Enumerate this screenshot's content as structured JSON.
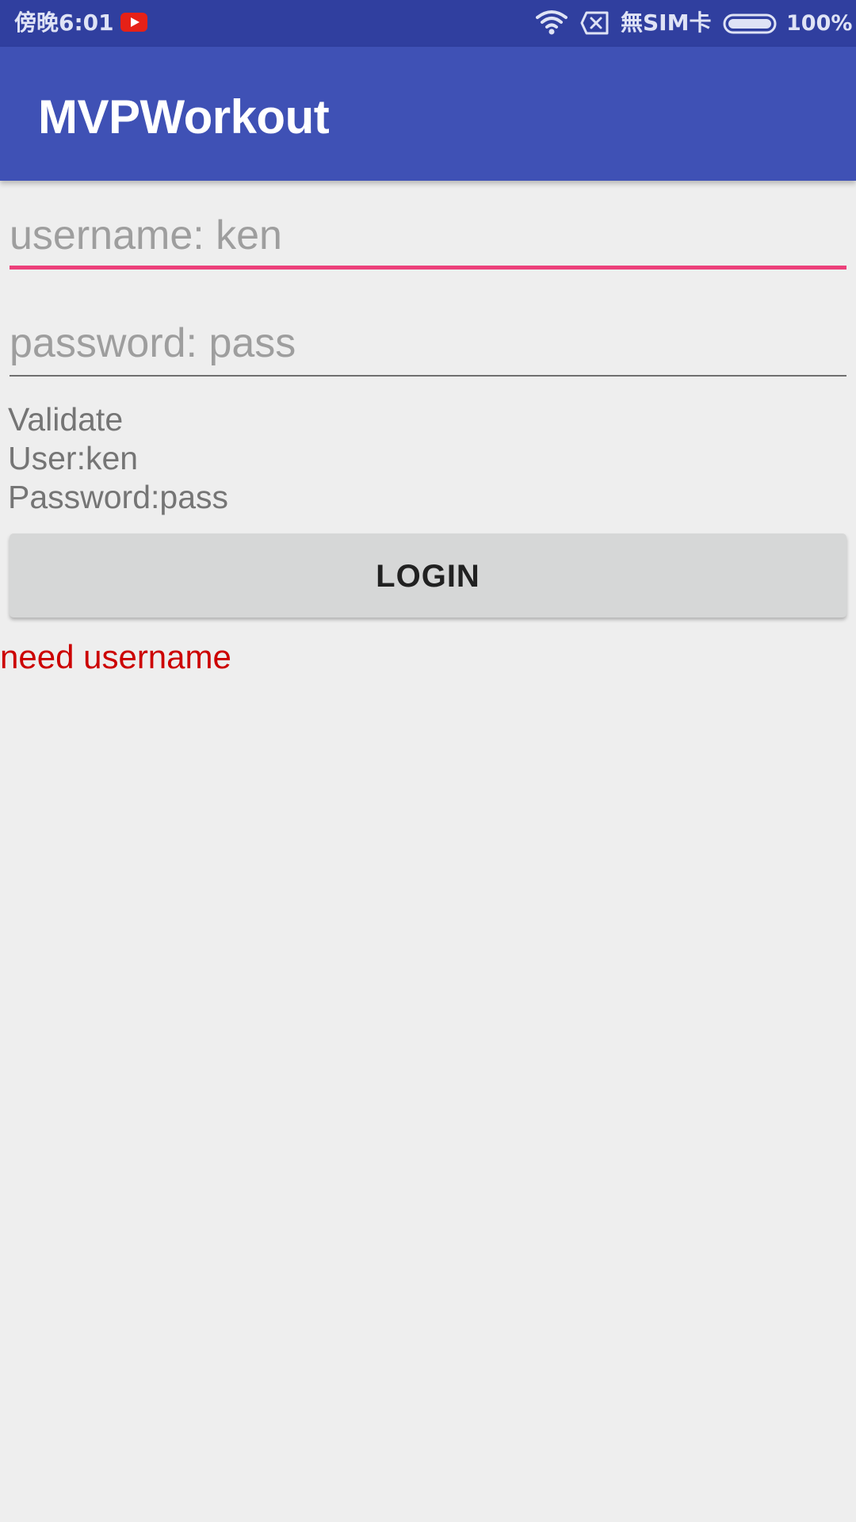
{
  "status_bar": {
    "time": "傍晚6:01",
    "sim_status": "無SIM卡",
    "battery_percent": "100%",
    "icons": [
      "youtube-notification-icon",
      "wifi-icon",
      "no-sim-icon",
      "battery-icon"
    ]
  },
  "app_bar": {
    "title": "MVPWorkout",
    "color": "#3f51b5"
  },
  "form": {
    "username": {
      "value": "",
      "placeholder": "username: ken",
      "focused": true,
      "accent_color": "#ec407a"
    },
    "password": {
      "value": "",
      "placeholder": "password: pass"
    },
    "validate_label": "Validate",
    "user_label": "User:ken",
    "password_label": "Password:pass",
    "login_button_label": "LOGIN",
    "error_message": "need username",
    "error_color": "#cc0000"
  }
}
